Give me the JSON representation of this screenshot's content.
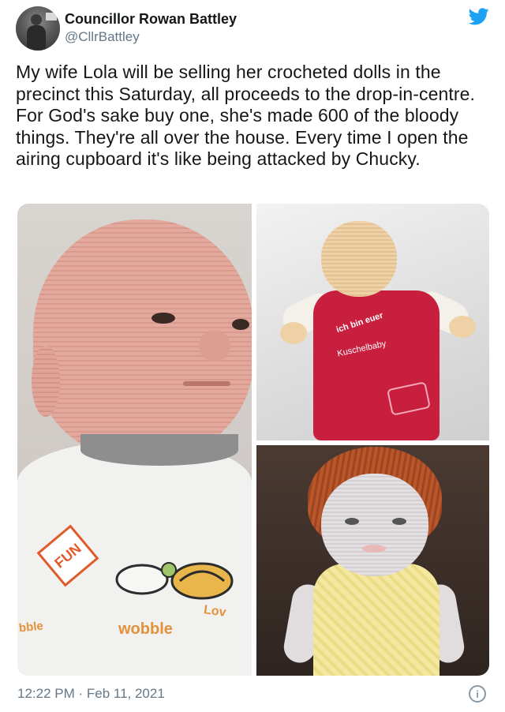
{
  "tweet": {
    "author": {
      "display_name": "Councillor Rowan Battley",
      "handle": "@CllrBattley"
    },
    "text": "My wife Lola will be selling her crocheted dolls in the precinct this Saturday, all proceeds to the drop-in-centre. For God's sake buy one, she's made 600 of the bloody things. They're all over the house. Every time I open the airing cupboard it's like being attacked by Chucky.",
    "timestamp": "12:22 PM · Feb 11, 2021",
    "icons": {
      "brand": "twitter-bird-icon",
      "info": "info-icon"
    },
    "colors": {
      "twitter_blue": "#1DA1F2",
      "secondary_text": "#657786"
    },
    "media": {
      "left_shirt": {
        "badge": "FUN",
        "text_1": "bble",
        "text_2": "wobble",
        "text_3": "Lov"
      },
      "top_right_outfit": {
        "line_1": "ich bin euer",
        "line_2": "Kuschelbaby"
      }
    }
  }
}
